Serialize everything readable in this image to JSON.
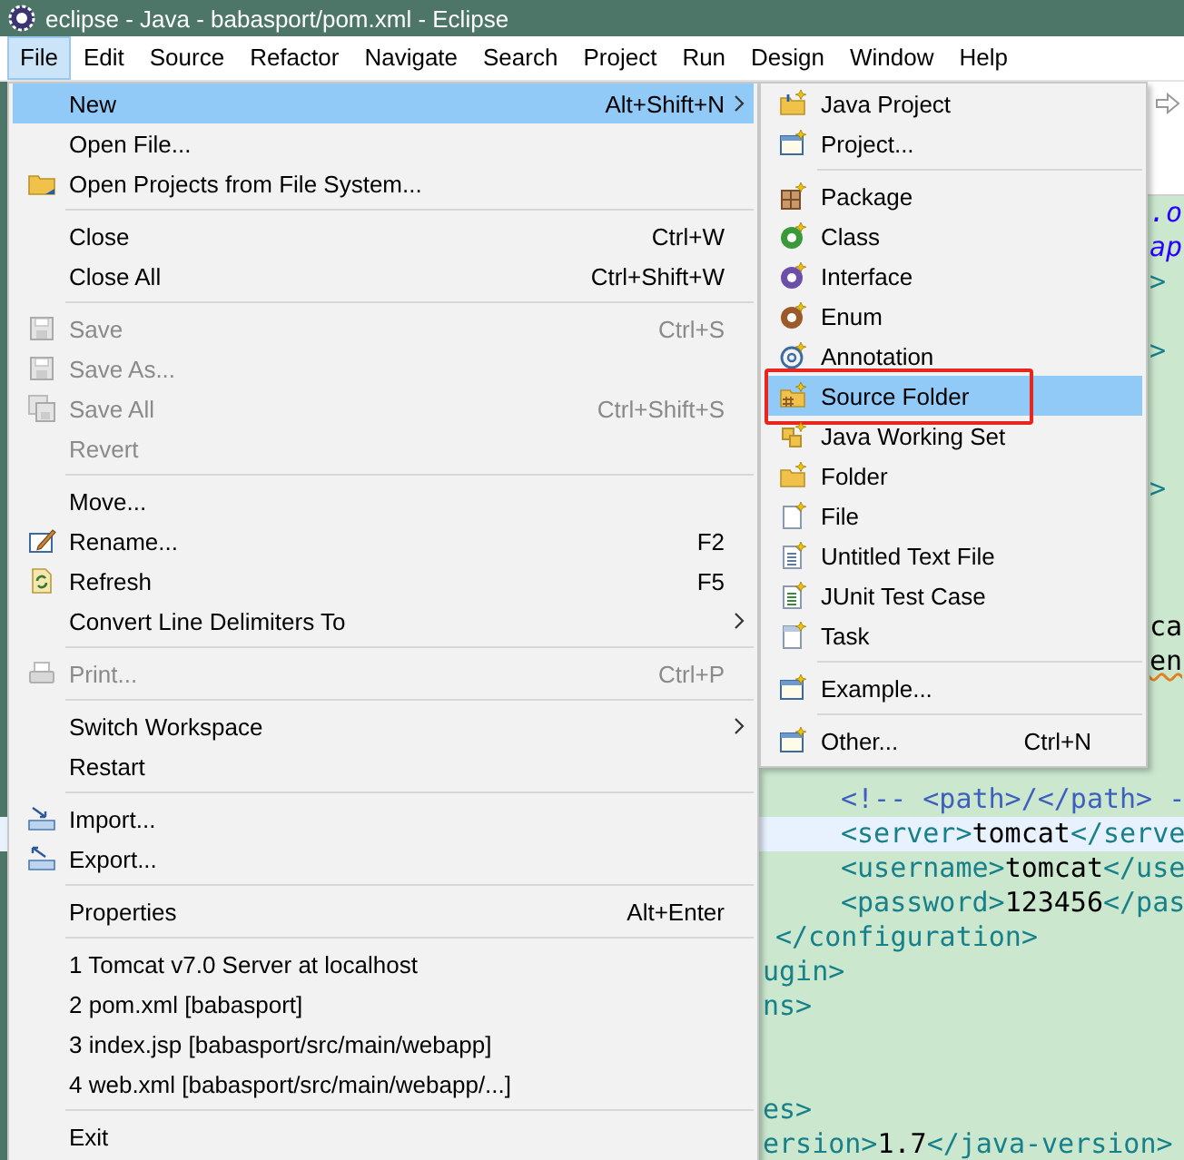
{
  "window": {
    "title": "eclipse - Java - babasport/pom.xml - Eclipse"
  },
  "menu_bar": [
    {
      "label": "File",
      "selected": true
    },
    {
      "label": "Edit",
      "selected": false
    },
    {
      "label": "Source",
      "selected": false
    },
    {
      "label": "Refactor",
      "selected": false
    },
    {
      "label": "Navigate",
      "selected": false
    },
    {
      "label": "Search",
      "selected": false
    },
    {
      "label": "Project",
      "selected": false
    },
    {
      "label": "Run",
      "selected": false
    },
    {
      "label": "Design",
      "selected": false
    },
    {
      "label": "Window",
      "selected": false
    },
    {
      "label": "Help",
      "selected": false
    }
  ],
  "file_menu": {
    "items": [
      {
        "kind": "item",
        "label": "New",
        "shortcut": "Alt+Shift+N",
        "submenu": true,
        "selected": true,
        "disabled": false
      },
      {
        "kind": "item",
        "label": "Open File...",
        "submenu": false,
        "selected": false,
        "disabled": false
      },
      {
        "kind": "item",
        "label": "Open Projects from File System...",
        "submenu": false,
        "selected": false,
        "disabled": false
      },
      {
        "kind": "separator"
      },
      {
        "kind": "item",
        "label": "Close",
        "shortcut": "Ctrl+W",
        "submenu": false,
        "selected": false,
        "disabled": false
      },
      {
        "kind": "item",
        "label": "Close All",
        "shortcut": "Ctrl+Shift+W",
        "submenu": false,
        "selected": false,
        "disabled": false
      },
      {
        "kind": "separator"
      },
      {
        "kind": "item",
        "label": "Save",
        "shortcut": "Ctrl+S",
        "submenu": false,
        "selected": false,
        "disabled": true
      },
      {
        "kind": "item",
        "label": "Save As...",
        "submenu": false,
        "selected": false,
        "disabled": true
      },
      {
        "kind": "item",
        "label": "Save All",
        "shortcut": "Ctrl+Shift+S",
        "submenu": false,
        "selected": false,
        "disabled": true
      },
      {
        "kind": "item",
        "label": "Revert",
        "submenu": false,
        "selected": false,
        "disabled": true
      },
      {
        "kind": "separator"
      },
      {
        "kind": "item",
        "label": "Move...",
        "submenu": false,
        "selected": false,
        "disabled": false
      },
      {
        "kind": "item",
        "label": "Rename...",
        "shortcut": "F2",
        "submenu": false,
        "selected": false,
        "disabled": false
      },
      {
        "kind": "item",
        "label": "Refresh",
        "shortcut": "F5",
        "submenu": false,
        "selected": false,
        "disabled": false
      },
      {
        "kind": "item",
        "label": "Convert Line Delimiters To",
        "submenu": true,
        "selected": false,
        "disabled": false
      },
      {
        "kind": "separator"
      },
      {
        "kind": "item",
        "label": "Print...",
        "shortcut": "Ctrl+P",
        "submenu": false,
        "selected": false,
        "disabled": true
      },
      {
        "kind": "separator"
      },
      {
        "kind": "item",
        "label": "Switch Workspace",
        "submenu": true,
        "selected": false,
        "disabled": false
      },
      {
        "kind": "item",
        "label": "Restart",
        "submenu": false,
        "selected": false,
        "disabled": false
      },
      {
        "kind": "separator"
      },
      {
        "kind": "item",
        "label": "Import...",
        "submenu": false,
        "selected": false,
        "disabled": false
      },
      {
        "kind": "item",
        "label": "Export...",
        "submenu": false,
        "selected": false,
        "disabled": false
      },
      {
        "kind": "separator"
      },
      {
        "kind": "item",
        "label": "Properties",
        "shortcut": "Alt+Enter",
        "submenu": false,
        "selected": false,
        "disabled": false
      },
      {
        "kind": "separator"
      },
      {
        "kind": "item",
        "label": "1 Tomcat v7.0 Server at localhost",
        "submenu": false,
        "selected": false,
        "disabled": false
      },
      {
        "kind": "item",
        "label": "2 pom.xml  [babasport]",
        "submenu": false,
        "selected": false,
        "disabled": false
      },
      {
        "kind": "item",
        "label": "3 index.jsp  [babasport/src/main/webapp]",
        "submenu": false,
        "selected": false,
        "disabled": false
      },
      {
        "kind": "item",
        "label": "4 web.xml  [babasport/src/main/webapp/...]",
        "submenu": false,
        "selected": false,
        "disabled": false
      },
      {
        "kind": "separator"
      },
      {
        "kind": "item",
        "label": "Exit",
        "submenu": false,
        "selected": false,
        "disabled": false
      }
    ]
  },
  "new_submenu": {
    "items": [
      {
        "kind": "item",
        "label": "Java Project",
        "selected": false,
        "annotated": false
      },
      {
        "kind": "item",
        "label": "Project...",
        "selected": false,
        "annotated": false
      },
      {
        "kind": "separator"
      },
      {
        "kind": "item",
        "label": "Package",
        "selected": false,
        "annotated": false
      },
      {
        "kind": "item",
        "label": "Class",
        "selected": false,
        "annotated": false
      },
      {
        "kind": "item",
        "label": "Interface",
        "selected": false,
        "annotated": false
      },
      {
        "kind": "item",
        "label": "Enum",
        "selected": false,
        "annotated": false
      },
      {
        "kind": "item",
        "label": "Annotation",
        "selected": false,
        "annotated": false
      },
      {
        "kind": "item",
        "label": "Source Folder",
        "selected": true,
        "annotated": true
      },
      {
        "kind": "item",
        "label": "Java Working Set",
        "selected": false,
        "annotated": false
      },
      {
        "kind": "item",
        "label": "Folder",
        "selected": false,
        "annotated": false
      },
      {
        "kind": "item",
        "label": "File",
        "selected": false,
        "annotated": false
      },
      {
        "kind": "item",
        "label": "Untitled Text File",
        "selected": false,
        "annotated": false
      },
      {
        "kind": "item",
        "label": "JUnit Test Case",
        "selected": false,
        "annotated": false
      },
      {
        "kind": "item",
        "label": "Task",
        "selected": false,
        "annotated": false
      },
      {
        "kind": "separator"
      },
      {
        "kind": "item",
        "label": "Example...",
        "selected": false,
        "annotated": false
      },
      {
        "kind": "separator"
      },
      {
        "kind": "item",
        "label": "Other...",
        "shortcut": "Ctrl+N",
        "selected": false,
        "annotated": false
      }
    ]
  },
  "editor": {
    "lines": [
      {
        "current": false,
        "segments": [
          {
            "kind": "value",
            "text": ".o"
          }
        ]
      },
      {
        "current": false,
        "segments": [
          {
            "kind": "value",
            "text": "ap"
          }
        ]
      },
      {
        "current": false,
        "segments": [
          {
            "kind": "tag",
            "text": ">"
          }
        ]
      },
      {
        "current": false,
        "segments": [
          {
            "kind": "tag",
            "text": ">"
          }
        ]
      },
      {
        "current": false,
        "segments": [
          {
            "kind": "tag",
            "text": ">"
          }
        ]
      },
      {
        "current": false,
        "segments": [
          {
            "kind": "text",
            "text": "ca"
          }
        ]
      },
      {
        "current": false,
        "segments": [
          {
            "kind": "misspelled",
            "text": "en"
          }
        ]
      },
      {
        "current": false,
        "segments": [
          {
            "kind": "comment",
            "text": "<!-- <path>/</path> -"
          }
        ]
      },
      {
        "current": true,
        "segments": [
          {
            "kind": "tag",
            "text": "<server>"
          },
          {
            "kind": "text",
            "text": "tomcat"
          },
          {
            "kind": "tag",
            "text": "</serve"
          }
        ]
      },
      {
        "current": false,
        "segments": [
          {
            "kind": "tag",
            "text": "<username>"
          },
          {
            "kind": "text",
            "text": "tomcat"
          },
          {
            "kind": "tag",
            "text": "</use"
          }
        ]
      },
      {
        "current": false,
        "segments": [
          {
            "kind": "tag",
            "text": "<password>"
          },
          {
            "kind": "text",
            "text": "123456"
          },
          {
            "kind": "tag",
            "text": "</pas"
          }
        ]
      },
      {
        "current": false,
        "segments": [
          {
            "kind": "tag",
            "text": "</configuration>"
          }
        ]
      },
      {
        "current": false,
        "segments": [
          {
            "kind": "tag",
            "text": "ugin>"
          }
        ]
      },
      {
        "current": false,
        "segments": [
          {
            "kind": "tag",
            "text": "ns>"
          }
        ]
      },
      {
        "current": false,
        "segments": [
          {
            "kind": "tag",
            "text": "es>"
          }
        ]
      },
      {
        "current": false,
        "segments": [
          {
            "kind": "tag",
            "text": "ersion>"
          },
          {
            "kind": "text",
            "text": "1.7"
          },
          {
            "kind": "tag",
            "text": "</java-version>"
          }
        ]
      }
    ]
  }
}
